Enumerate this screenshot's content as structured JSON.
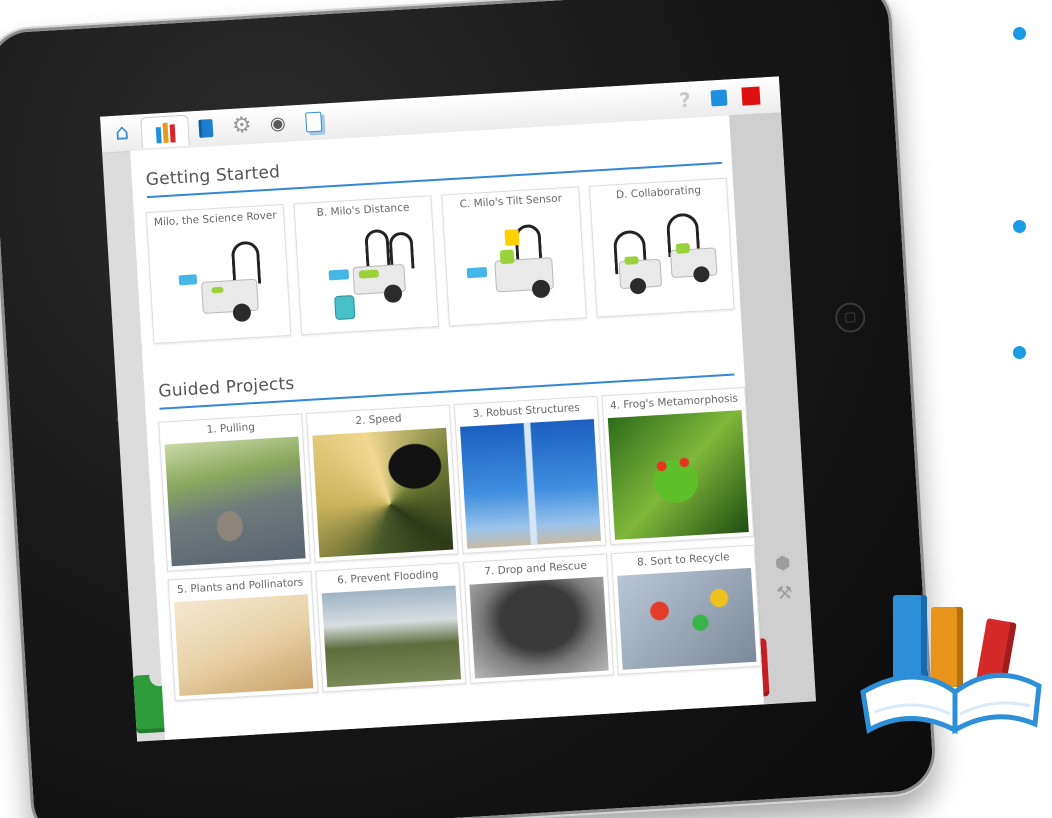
{
  "app": {
    "toolbar": {
      "tabs": [
        {
          "name": "home",
          "icon": "home-icon"
        },
        {
          "name": "library",
          "icon": "books-icon",
          "active": true
        },
        {
          "name": "projects",
          "icon": "book-icon"
        },
        {
          "name": "settings",
          "icon": "gear-icon"
        },
        {
          "name": "camera",
          "icon": "camera-icon"
        },
        {
          "name": "documentation",
          "icon": "document-icon"
        }
      ],
      "help_icon": "?",
      "accent_blue": "#1e8fe0",
      "accent_red": "#e01010"
    },
    "getting_started": {
      "title": "Getting Started",
      "cards": [
        {
          "label": "Milo, the Science Rover"
        },
        {
          "label": "B. Milo's Distance"
        },
        {
          "label": "C. Milo's Tilt Sensor"
        },
        {
          "label": "D. Collaborating"
        }
      ]
    },
    "guided_projects": {
      "title": "Guided Projects",
      "cards": [
        {
          "label": "1. Pulling"
        },
        {
          "label": "2. Speed"
        },
        {
          "label": "3. Robust Structures"
        },
        {
          "label": "4. Frog's Metamorphosis"
        },
        {
          "label": "5. Plants and Pollinators"
        },
        {
          "label": "6. Prevent Flooding"
        },
        {
          "label": "7. Drop and Rescue"
        },
        {
          "label": "8. Sort to Recycle"
        }
      ]
    },
    "colors": {
      "section_rule": "#3388d6",
      "block_green": "#2e9b3a",
      "block_red": "#c41f22",
      "cover": "#36b5e6",
      "bullet": "#1a9be6"
    }
  }
}
